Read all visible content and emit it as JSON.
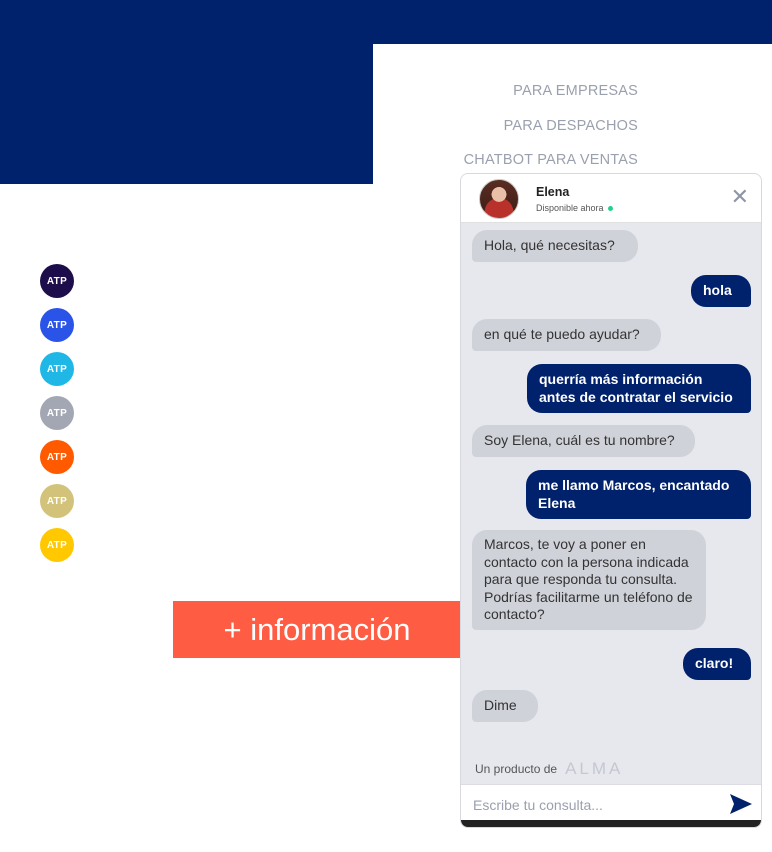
{
  "nav": {
    "items": [
      "PARA EMPRESAS",
      "PARA DESPACHOS",
      "CHATBOT PARA VENTAS"
    ]
  },
  "logos": [
    {
      "label": "ATP",
      "color": "#1d0d4a"
    },
    {
      "label": "ATP",
      "color": "#2a54e8"
    },
    {
      "label": "ATP",
      "color": "#1fb8e6"
    },
    {
      "label": "ATP",
      "color": "#a3a6b3"
    },
    {
      "label": "ATP",
      "color": "#ff5a00"
    },
    {
      "label": "ATP",
      "color": "#d3c37a"
    },
    {
      "label": "ATP",
      "color": "#ffc800"
    }
  ],
  "cta": {
    "label": "+ información",
    "color": "#ff5c44"
  },
  "chat": {
    "agent_name": "Elena",
    "agent_status": "Disponible ahora",
    "messages": [
      {
        "from": "bot",
        "text": "Hola, qué necesitas?"
      },
      {
        "from": "user",
        "text": "hola"
      },
      {
        "from": "bot",
        "text": "en qué te puedo ayudar?"
      },
      {
        "from": "user",
        "text": "querría más información antes de contratar el servicio"
      },
      {
        "from": "bot",
        "text": "Soy Elena, cuál es tu nombre?"
      },
      {
        "from": "user",
        "text": "me llamo Marcos, encantado Elena"
      },
      {
        "from": "bot",
        "text": "Marcos, te voy a poner en contacto con la persona indicada para que responda tu consulta. Podrías facilitarme un teléfono de contacto?"
      },
      {
        "from": "user",
        "text": "claro!"
      },
      {
        "from": "bot",
        "text": "Dime"
      }
    ],
    "footer_text": "Un producto de",
    "brand_name": "ALMA",
    "input_placeholder": "Escribe tu consulta..."
  },
  "colors": {
    "brand_navy": "#00216b",
    "accent": "#ff5c44"
  }
}
